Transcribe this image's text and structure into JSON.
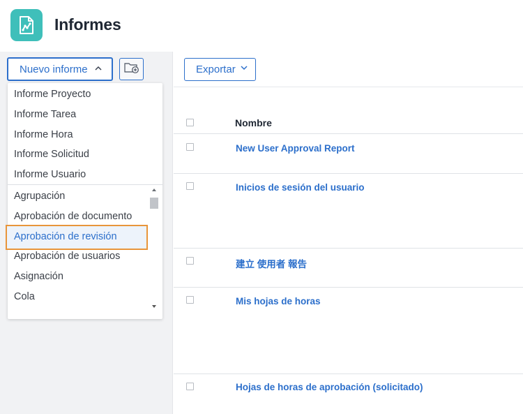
{
  "header": {
    "title": "Informes",
    "icon": "report-chart-icon",
    "icon_color": "#3fbfba"
  },
  "sidebar": {
    "new_report_label": "Nuevo informe",
    "new_report_chevron": "^",
    "new_folder_icon": "folder-plus-icon",
    "dropdown": {
      "primary_items": [
        "Informe Proyecto",
        "Informe Tarea",
        "Informe Hora",
        "Informe Solicitud",
        "Informe Usuario"
      ],
      "scroll_items": [
        "Agrupación",
        "Aprobación de documento",
        "Aprobación de revisión",
        "Aprobación de usuarios",
        "Asignación",
        "Cola"
      ],
      "highlighted_item": "Aprobación de revisión",
      "highlight_color": "#e8953a"
    }
  },
  "main": {
    "export_label": "Exportar",
    "export_chevron": "v",
    "column_header": "Nombre",
    "rows": [
      "New User Approval Report",
      "Inicios de sesión del usuario",
      "建立 使用者 報告",
      "Mis hojas de horas",
      "Hojas de horas de aprobación (solicitado)"
    ]
  },
  "colors": {
    "accent": "#2c6fcb",
    "sidebar_bg": "#f1f2f4"
  }
}
